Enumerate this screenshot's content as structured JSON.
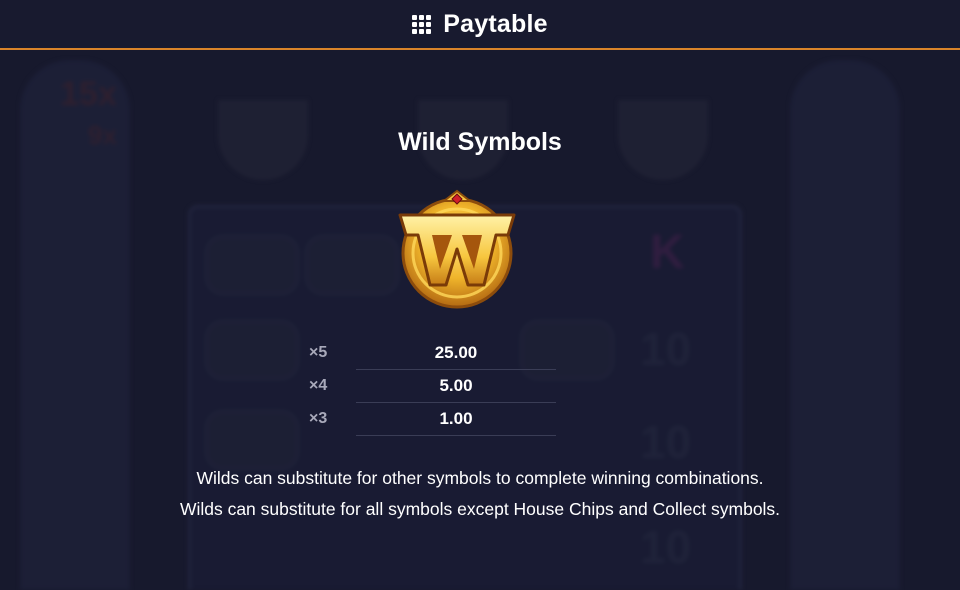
{
  "header": {
    "title": "Paytable",
    "icon": "menu-grid-icon"
  },
  "section": {
    "title": "Wild Symbols",
    "symbol_icon": "wild-w-icon",
    "symbol_letter": "W"
  },
  "paytable": [
    {
      "multiplier": "×5",
      "value": "25.00"
    },
    {
      "multiplier": "×4",
      "value": "5.00"
    },
    {
      "multiplier": "×3",
      "value": "1.00"
    }
  ],
  "descriptions": [
    "Wilds can substitute for other symbols to complete winning combinations.",
    "Wilds can substitute for all symbols except House Chips and Collect symbols."
  ],
  "colors": {
    "accent": "#d9842a",
    "background": "#1b1d33",
    "gold": "#f0b52b"
  }
}
